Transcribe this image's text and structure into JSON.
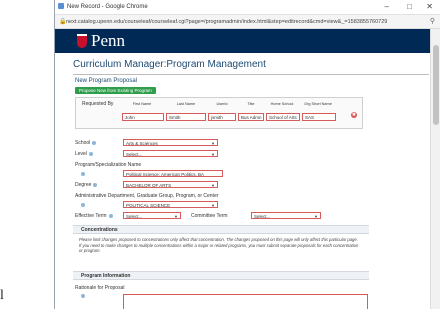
{
  "outer": {
    "corner_glyph": "l"
  },
  "window": {
    "title": "New Record - Google Chrome",
    "controls": {
      "minimize": "–",
      "maximize": "□",
      "close": "✕"
    }
  },
  "browser": {
    "url": "next.catalog.upenn.edu/courseleaf/courseleaf.cgi?page=/programadmin/index.html&step=editrecord&cmd=view&_=1583855760729",
    "zoom_icon": "zoom-icon"
  },
  "header": {
    "brand": "Penn"
  },
  "page": {
    "title": "Curriculum Manager:Program Management",
    "subtitle": "New Program Proposal",
    "propose_button": "Propose New from Existing Program"
  },
  "requested_by": {
    "label": "Requested By",
    "columns": [
      "First Name",
      "Last Name",
      "Userid",
      "Title",
      "Home School",
      "Org Short Name"
    ],
    "values": [
      "John",
      "Smith",
      "jsmith",
      "Bus Admn",
      "School of Arts",
      "SAS"
    ],
    "remove_icon": "✖"
  },
  "fields": {
    "school": {
      "label": "School",
      "value": "Arts & Sciences"
    },
    "level": {
      "label": "Level",
      "value": "Select..."
    },
    "program_name": {
      "label": "Program/Specialization Name",
      "value": "Political Science: American Politics, BA"
    },
    "degree": {
      "label": "Degree",
      "value": "BACHELOR OF ARTS"
    },
    "admin_dept": {
      "label": "Administrative Department, Graduate Group, Program, or Center",
      "value": "POLITICAL SCIENCE"
    },
    "effective_term": {
      "label": "Effective Term",
      "value": "Select..."
    },
    "committee_term": {
      "label": "Committee Term",
      "value": "Select..."
    }
  },
  "concentrations": {
    "heading": "Concentrations",
    "text": "Please limit changes proposed to concentrations only affect that concentration. The changes proposed on this page will only affect this particular page. If you need to make changes to multiple concentrations within a major or related programs, you must submit separate proposals for each concentration or program."
  },
  "program_information": {
    "heading": "Program Information",
    "rationale_label": "Rationale for Proposal"
  }
}
